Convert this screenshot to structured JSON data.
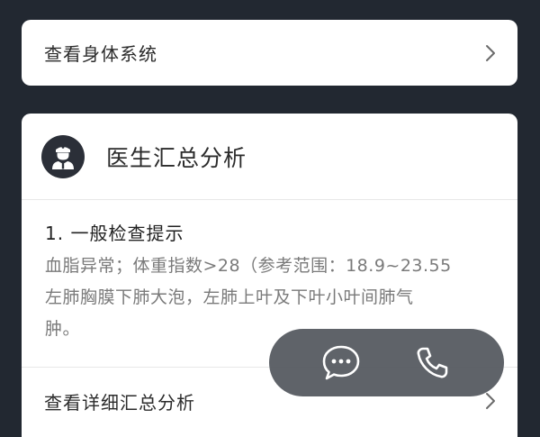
{
  "body_system_link": {
    "label": "查看身体系统",
    "icon": "chevron-right-icon"
  },
  "doctor_summary": {
    "avatar_icon": "doctor-icon",
    "title": "医生汇总分析",
    "section": {
      "title": "1. 一般检查提示",
      "body": "血脂异常；体重指数>28（参考范围：18.9~23.55\n左肺胸膜下肺大泡，左肺上叶及下叶小叶间肺气\n肿。"
    },
    "detail_link": {
      "label": "查看详细汇总分析",
      "icon": "chevron-right-icon"
    }
  },
  "floating_actions": {
    "chat_icon": "chat-bubble-icon",
    "phone_icon": "phone-icon"
  },
  "colors": {
    "background": "#222831",
    "card": "#ffffff",
    "floating_bar": "#55595f"
  }
}
